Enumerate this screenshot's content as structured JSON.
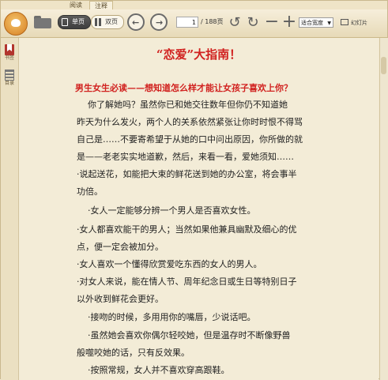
{
  "tabs": [
    {
      "label": "阅读"
    },
    {
      "label": "注释"
    }
  ],
  "toolbar": {
    "single_label": "单页",
    "double_label": "双页",
    "page_current": "1",
    "page_total": "/ 188页",
    "zoom_value": "适合宽度",
    "slideshow_label": "幻灯片"
  },
  "sidebar": {
    "items": [
      {
        "label": "书签"
      },
      {
        "label": "目录"
      }
    ]
  },
  "document": {
    "title": "“恋爱”大指南！",
    "subtitle": "男生女生必读——想知道怎么样才能让女孩子喜欢上你？",
    "lines": [
      "    你了解她吗？虽然你已和她交往数年但你仍不知道她",
      "昨天为什么发火，两个人的关系依然紧张让你时时恨不得骂",
      "自己是……不要寄希望于从她的口中问出原因，你所做的就",
      "是——老老实实地道歉，然后，来看一看，爱她须知……",
      "·说起送花，如能把大束的鲜花送到她的办公室，将会事半",
      "功倍。",
      "    ·女人一定能够分辨一个男人是否喜欢女性。",
      "·女人都喜欢能干的男人；当然如果他兼具幽默及细心的优",
      "点，便一定会被加分。",
      "·女人喜欢一个懂得欣赏爱吃东西的女人的男人。",
      "·对女人来说，能在情人节、周年纪念日或生日等特别日子",
      "以外收到鲜花会更好。",
      "    ·接吻的时候，多用用你的嘴唇，少说话吧。",
      "    ·虽然她会喜欢你偶尔轻咬她，但是温存时不断像野兽",
      "般噬咬她的话，只有反效果。",
      "    ·按照常规，女人并不喜欢穿高跟鞋。"
    ]
  }
}
